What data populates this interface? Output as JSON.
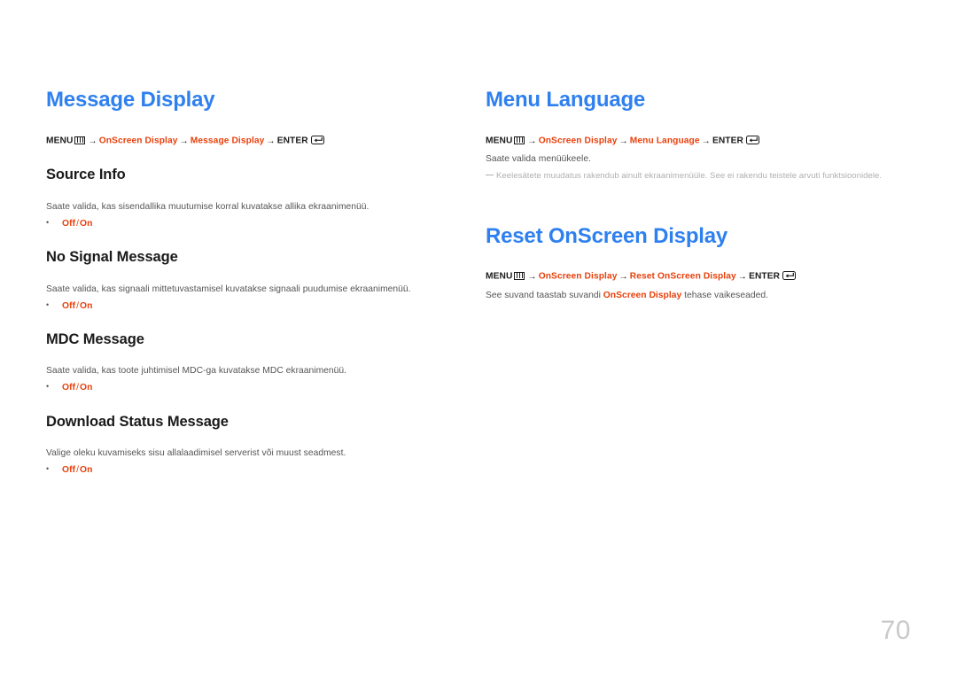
{
  "document": {
    "page_number": "70",
    "accent_blue": "#2f80ef",
    "accent_orange": "#e8400c",
    "body_gray": "#555555",
    "note_gray": "#b0b0b0"
  },
  "icons": {
    "menu": "menu-grid-icon",
    "enter": "enter-return-icon",
    "arrow": "→",
    "bullet": "•"
  },
  "left_column": {
    "title": "Message Display",
    "breadcrumb": {
      "menu_label": "MENU",
      "steps": [
        "OnScreen Display",
        "Message Display"
      ],
      "enter_label": "ENTER"
    },
    "subsections": [
      {
        "heading": "Source Info",
        "description": "Saate valida, kas sisendallika muutumise korral kuvatakse allika ekraanimenüü.",
        "options": [
          "Off",
          "On"
        ],
        "separator": "/"
      },
      {
        "heading": "No Signal Message",
        "description": "Saate valida, kas signaali mittetuvastamisel kuvatakse signaali puudumise ekraanimenüü.",
        "options": [
          "Off",
          "On"
        ],
        "separator": "/"
      },
      {
        "heading": "MDC Message",
        "description": "Saate valida, kas toote juhtimisel MDC-ga kuvatakse MDC ekraanimenüü.",
        "options": [
          "Off",
          "On"
        ],
        "separator": "/"
      },
      {
        "heading": "Download Status Message",
        "description": "Valige oleku kuvamiseks sisu allalaadimisel serverist või muust seadmest.",
        "options": [
          "Off",
          "On"
        ],
        "separator": "/"
      }
    ]
  },
  "right_column": {
    "sections": [
      {
        "title": "Menu Language",
        "breadcrumb": {
          "menu_label": "MENU",
          "steps": [
            "OnScreen Display",
            "Menu Language"
          ],
          "enter_label": "ENTER"
        },
        "description": "Saate valida menüükeele.",
        "note": "Keelesätete muudatus rakendub ainult ekraanimenüüle. See ei rakendu teistele arvuti funktsioonidele."
      },
      {
        "title": "Reset OnScreen Display",
        "breadcrumb": {
          "menu_label": "MENU",
          "steps": [
            "OnScreen Display",
            "Reset OnScreen Display"
          ],
          "enter_label": "ENTER"
        },
        "description_prefix": "See suvand taastab suvandi ",
        "description_highlight": "OnScreen Display",
        "description_suffix": " tehase vaikeseaded."
      }
    ]
  }
}
